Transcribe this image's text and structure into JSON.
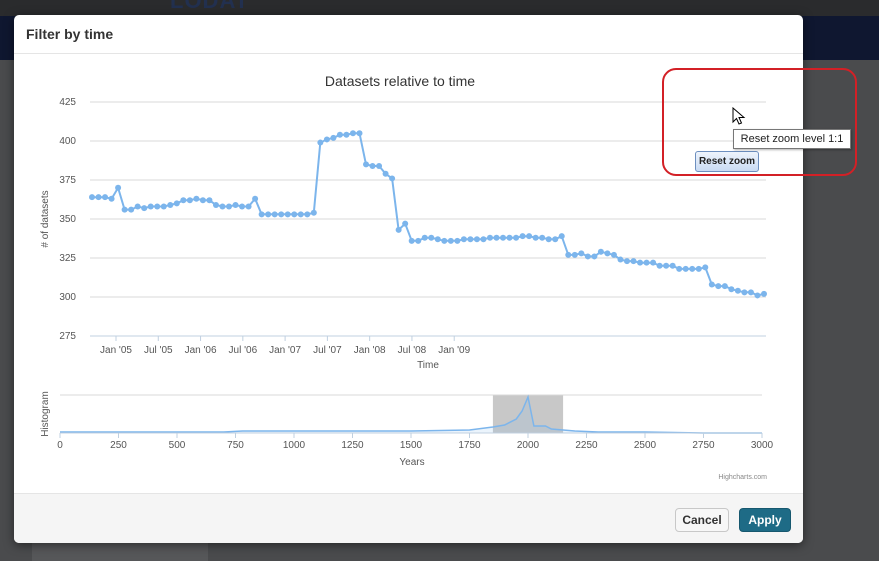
{
  "background": {
    "logo": "LODAT"
  },
  "modal": {
    "title": "Filter by time",
    "footer": {
      "cancel_label": "Cancel",
      "apply_label": "Apply"
    }
  },
  "reset_zoom": {
    "label": "Reset zoom",
    "tooltip": "Reset zoom level 1:1"
  },
  "colors": {
    "series": "#7cb5ec",
    "apply_button": "#1e6b86",
    "annotation": "#d32026",
    "nav_selection": "#c8c8c8"
  },
  "credit": "Highcharts.com",
  "chart_data": [
    {
      "type": "line",
      "title": "Datasets relative to time",
      "xlabel": "Time",
      "ylabel": "# of datasets",
      "ylim": [
        275,
        425
      ],
      "yticks": [
        275,
        300,
        325,
        350,
        375,
        400,
        425
      ],
      "xticks": [
        "Jan '05",
        "Jul '05",
        "Jan '06",
        "Jul '06",
        "Jan '07",
        "Jul '07",
        "Jan '08",
        "Jul '08",
        "Jan '09"
      ],
      "grid": true,
      "markers": true,
      "values": [
        364,
        364,
        364,
        363,
        370,
        356,
        356,
        358,
        357,
        358,
        358,
        358,
        359,
        360,
        362,
        362,
        363,
        362,
        362,
        359,
        358,
        358,
        359,
        358,
        358,
        363,
        353,
        353,
        353,
        353,
        353,
        353,
        353,
        353,
        354,
        399,
        401,
        402,
        404,
        404,
        405,
        405,
        385,
        384,
        384,
        379,
        376,
        343,
        347,
        336,
        336,
        338,
        338,
        337,
        336,
        336,
        336,
        337,
        337,
        337,
        337,
        338,
        338,
        338,
        338,
        338,
        339,
        339,
        338,
        338,
        337,
        337,
        339,
        327,
        327,
        328,
        326,
        326,
        329,
        328,
        327,
        324,
        323,
        323,
        322,
        322,
        322,
        320,
        320,
        320,
        318,
        318,
        318,
        318,
        319,
        308,
        307,
        307,
        305,
        304,
        303,
        303,
        301,
        302
      ]
    },
    {
      "type": "area",
      "ylabel": "Histogram",
      "xlabel": "Years",
      "xlim": [
        0,
        3000
      ],
      "xticks": [
        0,
        250,
        500,
        750,
        1000,
        1250,
        1500,
        1750,
        2000,
        2250,
        2500,
        2750,
        3000
      ],
      "selected_range": [
        1850,
        2150
      ],
      "series": [
        {
          "x": [
            0,
            700,
            780,
            1100,
            1500,
            1750,
            1850,
            1900,
            1950,
            1975,
            2000,
            2025,
            2075,
            2100,
            2150,
            2200,
            2300,
            2500,
            2750,
            3000
          ],
          "y": [
            1,
            1,
            2,
            2,
            2,
            3,
            6,
            8,
            14,
            22,
            36,
            7,
            7,
            4,
            3,
            2,
            1,
            1,
            0,
            0
          ]
        }
      ]
    }
  ]
}
